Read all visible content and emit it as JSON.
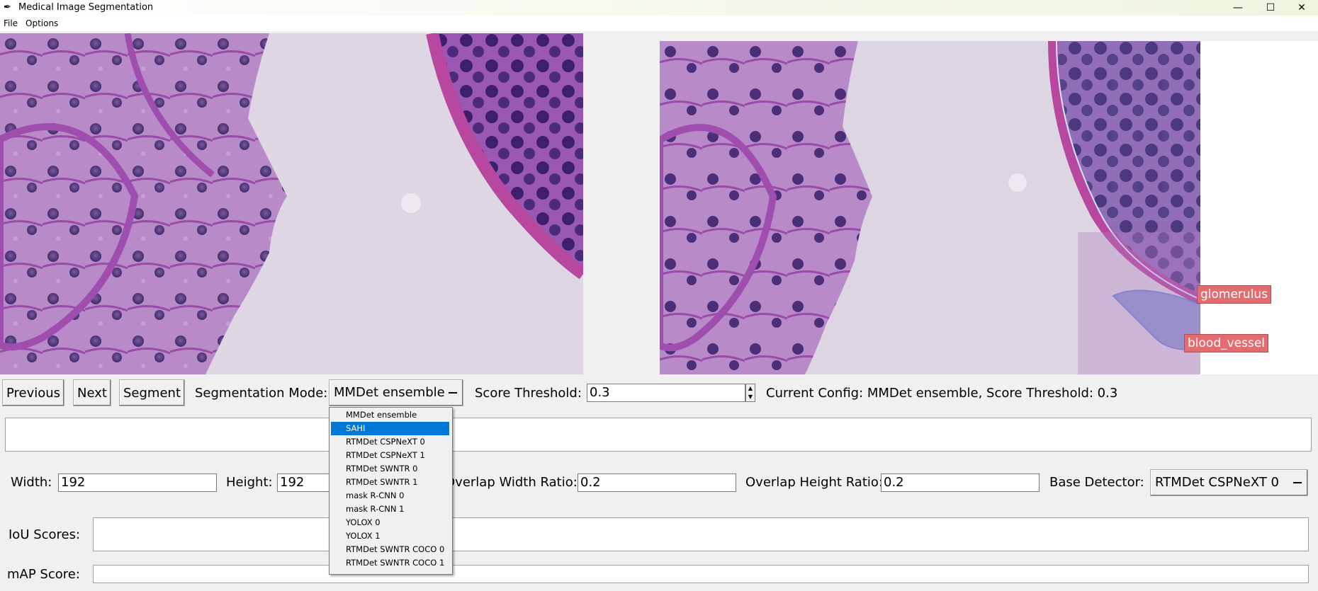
{
  "window": {
    "title": "Medical Image Segmentation",
    "minimize": "—",
    "maximize": "☐",
    "close": "✕"
  },
  "menubar": {
    "file": "File",
    "options": "Options"
  },
  "annotations": {
    "glomerulus": "glomerulus",
    "blood_vessel": "blood_vessel"
  },
  "controls": {
    "previous": "Previous",
    "next": "Next",
    "segment": "Segment",
    "seg_mode_label": "Segmentation Mode:",
    "seg_mode_value": "MMDet ensemble",
    "score_threshold_label": "Score Threshold:",
    "score_threshold_value": "0.3",
    "current_config": "Current Config: MMDet ensemble, Score Threshold: 0.3"
  },
  "sahi": {
    "width_label": "Width:",
    "width_value": "192",
    "height_label": "Height:",
    "height_value": "192",
    "overlap_w_label": "Overlap Width Ratio:",
    "overlap_w_value": "0.2",
    "overlap_h_label": "Overlap Height Ratio:",
    "overlap_h_value": "0.2",
    "base_detector_label": "Base Detector:",
    "base_detector_value": "RTMDet CSPNeXT 0"
  },
  "scores": {
    "iou_label": "IoU Scores:",
    "map_label": "mAP Score:"
  },
  "dropdown": {
    "items": [
      "MMDet ensemble",
      "SAHI",
      "RTMDet CSPNeXT 0",
      "RTMDet CSPNeXT 1",
      "RTMDet SWNTR 0",
      "RTMDet SWNTR 1",
      "mask R-CNN 0",
      "mask R-CNN 1",
      "YOLOX 0",
      "YOLOX 1",
      "RTMDet SWNTR COCO 0",
      "RTMDet SWNTR COCO 1"
    ],
    "selected_index": 1
  },
  "colors": {
    "highlight": "#0078d7",
    "label_bg": "#e36c70",
    "tissue": "#b583c9"
  }
}
